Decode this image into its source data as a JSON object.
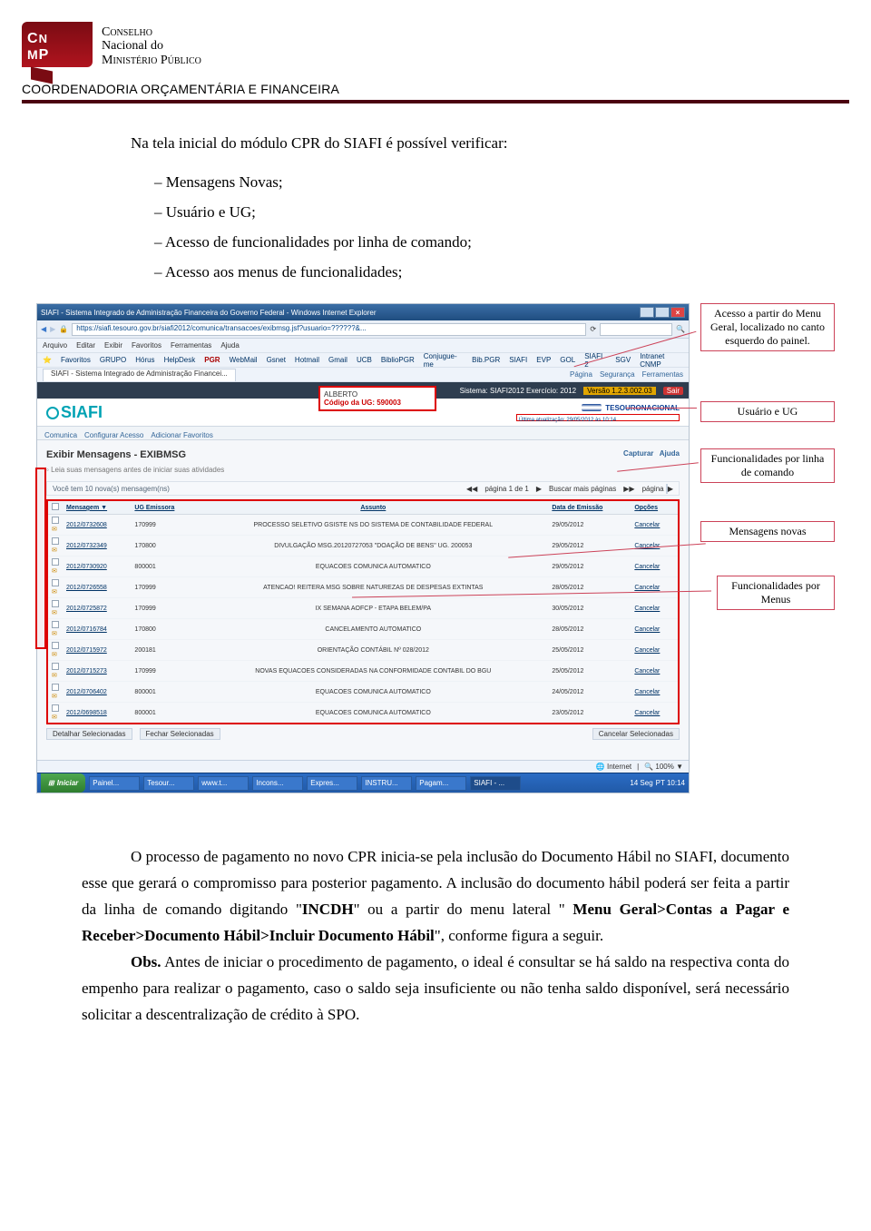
{
  "header": {
    "logo_text": "CNMP",
    "l1": "Conselho",
    "l2": "Nacional do",
    "l3": "Ministério Público",
    "coord": "COORDENADORIA ORÇAMENTÁRIA E FINANCEIRA"
  },
  "intro": "Na tela inicial do módulo CPR do SIAFI é possível verificar:",
  "bullets": [
    "Mensagens Novas;",
    "Usuário e UG;",
    "Acesso de funcionalidades por linha de comando;",
    "Acesso aos menus de funcionalidades;"
  ],
  "callouts": {
    "a": "Acesso a partir do Menu Geral, localizado no canto esquerdo do painel.",
    "b": "Usuário e UG",
    "c": "Funcionalidades por linha de comando",
    "d": "Mensagens novas",
    "e": "Funcionalidades por Menus"
  },
  "shot": {
    "title": "SIAFI - Sistema Integrado de Administração Financeira do Governo Federal - Windows Internet Explorer",
    "url": "https://siafi.tesouro.gov.br/siafi2012/comunica/transacoes/exibmsg.jsf?usuario=??????&...",
    "menubar": [
      "Arquivo",
      "Editar",
      "Exibir",
      "Favoritos",
      "Ferramentas",
      "Ajuda"
    ],
    "fav_items": [
      "Favoritos",
      "GRUPO",
      "Hórus",
      "HelpDesk",
      "PGR",
      "WebMail",
      "Gsnet",
      "Hotmail",
      "Gmail",
      "UCB",
      "BiblioPGR",
      "Conjugue-me",
      "Bib.PGR",
      "SIAFI",
      "EVP",
      "GOL",
      "SIAFI 2",
      "SGV",
      "Intranet CNMP"
    ],
    "tab": "SIAFI - Sistema Integrado de Administração Financei...",
    "tb_right": [
      "Página",
      "Segurança",
      "Ferramentas"
    ],
    "sysline_left": "Sistema: SIAFI2012 Exercício: 2012",
    "sysline_right": "Versão 1.2.3.002.03",
    "sair": "Sair",
    "ug_name": "ALBERTO",
    "ug_code": "Código da UG: 590003",
    "brand": "SIAFI",
    "tes": "TESOURONACIONAL",
    "last_update": "Última atualização: 29/05/2012 às 10:14",
    "tabs": [
      "Comunica",
      "Configurar Acesso",
      "Adicionar Favoritos"
    ],
    "h1": "Exibir Mensagens - EXIBMSG",
    "h1r_capture": "Capturar",
    "h1r_help": "Ajuda",
    "sub": "Leia suas mensagens antes de iniciar suas atividades",
    "pager_count": "Você tem 10 nova(s) mensagem(ns)",
    "pager_mid": "página 1 de 1",
    "pager_buscar": "Buscar mais páginas",
    "pager_label": "página",
    "cols": [
      "",
      "Mensagem ▼",
      "UG Emissora",
      "Assunto",
      "Data de Emissão",
      "Opções"
    ],
    "rows": [
      [
        "2012/0732608",
        "170999",
        "PROCESSO SELETIVO GSISTE NS DO SISTEMA DE CONTABILIDADE FEDERAL",
        "29/05/2012"
      ],
      [
        "2012/0732349",
        "170800",
        "DIVULGAÇÃO MSG.20120727053 \"DOAÇÃO DE BENS\" UG. 200053",
        "29/05/2012"
      ],
      [
        "2012/0730920",
        "800001",
        "EQUACOES COMUNICA AUTOMATICO",
        "29/05/2012"
      ],
      [
        "2012/0726558",
        "170999",
        "ATENCAO! REITERA MSG SOBRE NATUREZAS DE DESPESAS EXTINTAS",
        "28/05/2012"
      ],
      [
        "2012/0725872",
        "170999",
        "IX SEMANA AOFCP - ETAPA BELEM/PA",
        "30/05/2012"
      ],
      [
        "2012/0716784",
        "170800",
        "CANCELAMENTO AUTOMATICO",
        "28/05/2012"
      ],
      [
        "2012/0715972",
        "200181",
        "ORIENTAÇÃO CONTÁBIL Nº 028/2012",
        "25/05/2012"
      ],
      [
        "2012/0715273",
        "170999",
        "NOVAS EQUACOES CONSIDERADAS NA CONFORMIDADE CONTABIL DO BGU",
        "25/05/2012"
      ],
      [
        "2012/0706402",
        "800001",
        "EQUACOES COMUNICA AUTOMATICO",
        "24/05/2012"
      ],
      [
        "2012/0698518",
        "800001",
        "EQUACOES COMUNICA AUTOMATICO",
        "23/05/2012"
      ]
    ],
    "cancel": "Cancelar",
    "cancel_sel": "Cancelar Selecionadas",
    "detalhar": "Detalhar Selecionadas",
    "fechar": "Fechar Selecionadas",
    "internet": "Internet",
    "zoom": "100%",
    "start": "Iniciar",
    "tasks": [
      "",
      "Painel...",
      "Tesour...",
      "www.t...",
      "Incons...",
      "Expres...",
      "INSTRU...",
      "Pagam..."
    ],
    "task_sel": "SIAFI - ...",
    "clock": "PT   10:14",
    "tray_ico": "14 Seg"
  },
  "para2": {
    "p1a": "O processo de pagamento no novo CPR inicia-se pela inclusão do Documento Hábil no SIAFI, documento esse que gerará o compromisso para posterior pagamento. A inclusão do documento hábil poderá ser feita a partir da linha de comando digitando \"",
    "incdh": "INCDH",
    "p1b": "\" ou a partir do menu lateral \" ",
    "path": "Menu Geral>Contas a Pagar e Receber>Documento Hábil>Incluir Documento Hábil",
    "p1c": "\", conforme figura a seguir.",
    "obs_lbl": "Obs.",
    "obs": " Antes de iniciar o procedimento de pagamento, o ideal é consultar se há saldo na respectiva conta do empenho para realizar o pagamento, caso o saldo seja insuficiente ou não tenha saldo disponível, será necessário solicitar a descentralização de crédito à SPO."
  }
}
